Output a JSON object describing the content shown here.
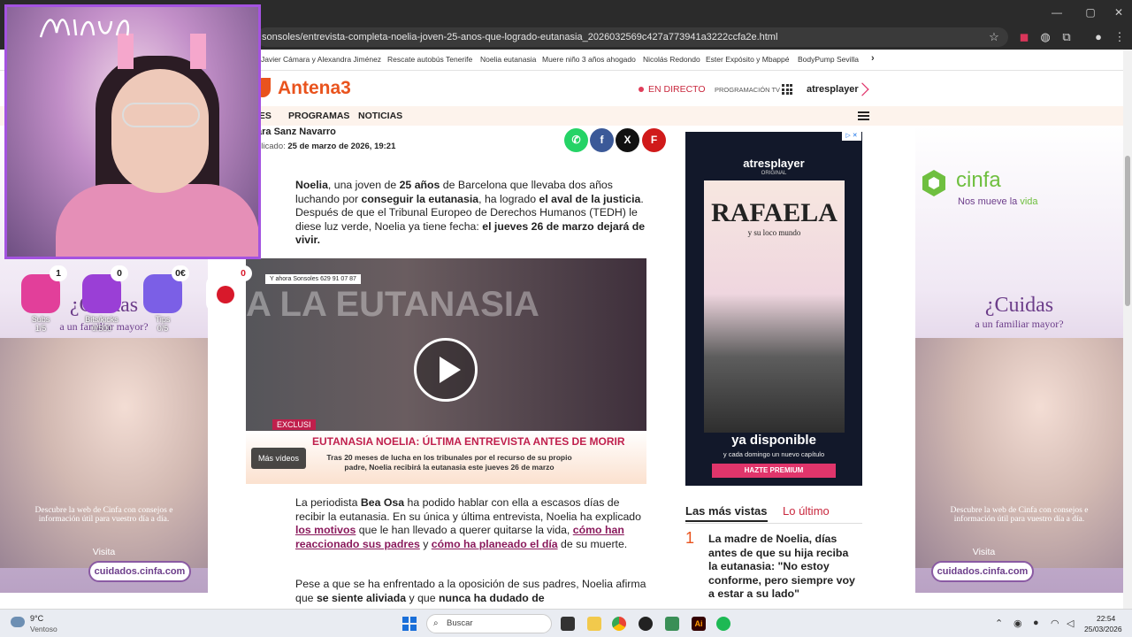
{
  "browser": {
    "url": "sonsoles/entrevista-completa-noelia-joven-25-anos-que-logrado-eutanasia_2026032569c427a773941a3222ccfa2e.html",
    "window_controls": [
      "—",
      "▢",
      "✕"
    ],
    "bookmarks": [
      "Javier Cámara y Alexandra Jiménez",
      "Rescate autobús Tenerife",
      "Noelia eutanasia",
      "Muere niño 3 años ahogado",
      "Nicolás Redondo",
      "Ester Expósito y Mbappé",
      "BodyPump Sevilla"
    ],
    "bookmarks_more": "›"
  },
  "site": {
    "logo": "Antena3",
    "live": "EN DIRECTO",
    "programacion": "PROGRAMACIÓN TV",
    "atresplayer": "atresplayer",
    "nav": [
      "IES",
      "PROGRAMAS",
      "NOTICIAS"
    ]
  },
  "article": {
    "author": "ara Sanz Navarro",
    "date_label": "blicado:",
    "date_value": "25 de marzo de 2026, 19:21",
    "share": {
      "whatsapp": "✆",
      "facebook": "f",
      "x": "X",
      "flipboard": "F"
    },
    "lead": {
      "p1": "Noelia",
      "p2": ", una joven de ",
      "p3": "25 años",
      "p4": " de Barcelona que llevaba dos años luchando por ",
      "p5": "conseguir la eutanasia",
      "p6": ", ha logrado ",
      "p7": "el aval de la justicia",
      "p8": ". Después de que el Tribunal Europeo de Derechos Humanos (TEDH) le diese luz verde, Noelia ya tiene fecha: ",
      "p9": "el jueves 26 de marzo dejará de vivir."
    },
    "para2": {
      "a": "La periodista ",
      "b": "Bea Osa",
      "c": " ha podido hablar con ella a escasos días de recibir la eutanasia. En su única y última entrevista, Noelia ha explicado ",
      "d": "los motivos",
      "e": " que le han llevado a querer quitarse la vida, ",
      "f": "cómo han reaccionado sus padres",
      "g": " y ",
      "h": "cómo ha planeado el día",
      "i": " de su muerte."
    },
    "para3": {
      "a": "Pese a que se ha enfrentado a la oposición de sus padres, Noelia afirma que ",
      "b": "se siente aliviada",
      "c": " y que ",
      "d": "nunca ha dudado de"
    }
  },
  "video": {
    "bg_text": "A LA EUTANASIA",
    "phone_banner": "Y ahora Sonsoles  629 91 07 87",
    "exclusiva": "EXCLUSI",
    "headline": "EUTANASIA NOELIA: ÚLTIMA ENTREVISTA ANTES DE MORIR",
    "subline": "Tras 20 meses de lucha en los tribunales por el recurso de su propio padre, Noelia recibirá la eutanasia este jueves 26 de marzo",
    "more": "Más vídeos"
  },
  "ads": {
    "cinfa_brand": "cinfa",
    "cinfa_tagline_a": "Nos mueve la ",
    "cinfa_tagline_b": "vida",
    "question": "¿Cuidas",
    "question2": "a un familiar mayor?",
    "desc": "Descubre la web de Cinfa con consejos e información útil para vuestro día a día.",
    "visita": "Visita",
    "button": "cuidados.cinfa.com",
    "atres_brand": "atresplayer",
    "atres_original": "ORIGINAL",
    "poster_title": "RAFAELA",
    "poster_sub": "y su loco mundo",
    "disponible": "ya disponible",
    "disponible_sub": "y cada domingo un nuevo capítulo",
    "cta": "HAZTE PREMIUM",
    "ad_choices": "▷ ✕"
  },
  "most_viewed": {
    "tab_active": "Las más vistas",
    "tab_other": "Lo último",
    "rank": "1",
    "title": "La madre de Noelia, días antes de que su hija reciba la eutanasia: \"No estoy conforme, pero siempre voy a estar a su lado\""
  },
  "stream": {
    "goals": [
      {
        "label": "Subs",
        "count": "1/5",
        "badge": "1",
        "color": "#e23f9a"
      },
      {
        "label": "Bits/kicks",
        "count": "0/500",
        "badge": "0",
        "color": "#9a3fd6"
      },
      {
        "label": "Tips",
        "count": "0/5",
        "badge": "0€",
        "color": "#7b5fe6"
      },
      {
        "label": "",
        "count": "",
        "badge": "0",
        "color": "#ffffff"
      }
    ]
  },
  "taskbar": {
    "weather_temp": "9°C",
    "weather_desc": "Ventoso",
    "search": "Buscar",
    "time": "22:54",
    "date": "25/03/2026"
  }
}
